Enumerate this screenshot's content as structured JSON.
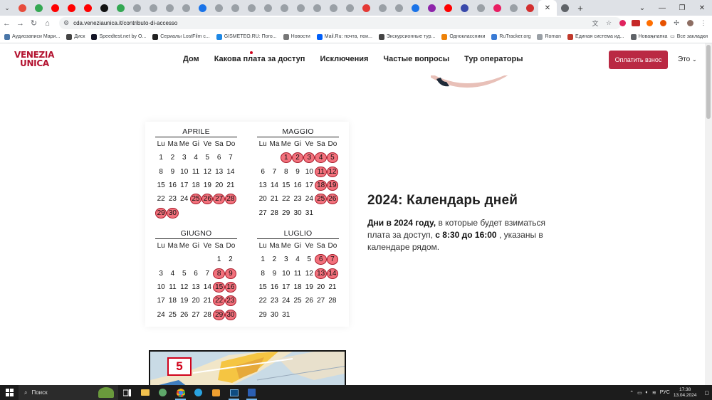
{
  "browser": {
    "url": "cda.veneziaunica.it/contributo-di-accesso",
    "tab_colors": [
      "#e74c3c",
      "#34a853",
      "#ff0000",
      "#ff0000",
      "#ff0000",
      "#111111",
      "#34a853",
      "#9aa0a6",
      "#9aa0a6",
      "#9aa0a6",
      "#9aa0a6",
      "#1a73e8",
      "#9aa0a6",
      "#9aa0a6",
      "#9aa0a6",
      "#9aa0a6",
      "#9aa0a6",
      "#9aa0a6",
      "#9aa0a6",
      "#9aa0a6",
      "#9aa0a6",
      "#e53935",
      "#9aa0a6",
      "#9aa0a6",
      "#1a73e8",
      "#8e24aa",
      "#ff0000",
      "#3949ab",
      "#9aa0a6",
      "#e91e63",
      "#9aa0a6",
      "#d32f2f",
      "#9aa0a6",
      "#5f6368"
    ],
    "new_tab": "+",
    "bookmarks": [
      {
        "label": "Аудиозаписи Мари...",
        "color": "#4a76a8"
      },
      {
        "label": "Диск",
        "color": "#444444"
      },
      {
        "label": "Speedtest.net by O...",
        "color": "#141526"
      },
      {
        "label": "Сериалы LostFilm с...",
        "color": "#222222"
      },
      {
        "label": "GISMETEO.RU: Пого...",
        "color": "#1e88e5"
      },
      {
        "label": "Новости",
        "color": "#777777"
      },
      {
        "label": "Mail.Ru: почта, пои...",
        "color": "#005ff9"
      },
      {
        "label": "Экскурсионные тур...",
        "color": "#444444"
      },
      {
        "label": "Одноклассники",
        "color": "#ee8208"
      },
      {
        "label": "RuTracker.org",
        "color": "#3a7bd5"
      },
      {
        "label": "Roman",
        "color": "#9aa0a6"
      },
      {
        "label": "Единая система ид...",
        "color": "#c0392b"
      },
      {
        "label": "Новая папка",
        "color": "#5f6368"
      }
    ],
    "bookmarks_more": "»",
    "all_bookmarks": "Все закладки"
  },
  "site": {
    "logo_line1": "VENEZIA",
    "logo_line2": "UNICA",
    "nav": [
      "Дом",
      "Какова плата за доступ",
      "Исключения",
      "Частые вопросы",
      "Тур операторы"
    ],
    "pay_button": "Оплатить взнос",
    "language": "Это"
  },
  "calendar": {
    "weekdays": [
      "Lu",
      "Ma",
      "Me",
      "Gi",
      "Ve",
      "Sa",
      "Do"
    ],
    "months": [
      {
        "name": "APRILE",
        "weeks": [
          [
            "1",
            "2",
            "3",
            "4",
            "5",
            "6",
            "7"
          ],
          [
            "8",
            "9",
            "10",
            "11",
            "12",
            "13",
            "14"
          ],
          [
            "15",
            "16",
            "17",
            "18",
            "19",
            "20",
            "21"
          ],
          [
            "22",
            "23",
            "24",
            "25",
            "26",
            "27",
            "28"
          ],
          [
            "29",
            "30",
            "",
            "",
            "",
            "",
            ""
          ]
        ],
        "highlighted": [
          "25",
          "26",
          "27",
          "28",
          "29",
          "30"
        ]
      },
      {
        "name": "MAGGIO",
        "weeks": [
          [
            "",
            "",
            "1",
            "2",
            "3",
            "4",
            "5"
          ],
          [
            "6",
            "7",
            "8",
            "9",
            "10",
            "11",
            "12"
          ],
          [
            "13",
            "14",
            "15",
            "16",
            "17",
            "18",
            "19"
          ],
          [
            "20",
            "21",
            "22",
            "23",
            "24",
            "25",
            "26"
          ],
          [
            "27",
            "28",
            "29",
            "30",
            "31",
            "",
            ""
          ]
        ],
        "highlighted": [
          "1",
          "2",
          "3",
          "4",
          "5",
          "11",
          "12",
          "18",
          "19",
          "25",
          "26"
        ]
      },
      {
        "name": "GIUGNO",
        "weeks": [
          [
            "",
            "",
            "",
            "",
            "",
            "1",
            "2"
          ],
          [
            "3",
            "4",
            "5",
            "6",
            "7",
            "8",
            "9"
          ],
          [
            "10",
            "11",
            "12",
            "13",
            "14",
            "15",
            "16"
          ],
          [
            "17",
            "18",
            "19",
            "20",
            "21",
            "22",
            "23"
          ],
          [
            "24",
            "25",
            "26",
            "27",
            "28",
            "29",
            "30"
          ]
        ],
        "highlighted": [
          "8",
          "9",
          "15",
          "16",
          "22",
          "23",
          "29",
          "30"
        ]
      },
      {
        "name": "LUGLIO",
        "weeks": [
          [
            "1",
            "2",
            "3",
            "4",
            "5",
            "6",
            "7"
          ],
          [
            "8",
            "9",
            "10",
            "11",
            "12",
            "13",
            "14"
          ],
          [
            "15",
            "16",
            "17",
            "18",
            "19",
            "20",
            "21"
          ],
          [
            "22",
            "23",
            "24",
            "25",
            "26",
            "27",
            "28"
          ],
          [
            "29",
            "30",
            "31",
            "",
            "",
            "",
            ""
          ]
        ],
        "highlighted": [
          "6",
          "7",
          "13",
          "14"
        ]
      }
    ]
  },
  "info": {
    "title": "2024: Календарь дней",
    "body_bold1": "Дни в 2024 году,",
    "body_text1": " в которые будет взиматься плата за доступ, ",
    "body_bold2": "с 8:30 до 16:00",
    "body_text2": " , указаны в календаре рядом."
  },
  "map": {
    "number": "5"
  },
  "taskbar": {
    "search_placeholder": "Поиск",
    "language": "РУС",
    "time": "17:38",
    "date": "13.04.2024"
  }
}
